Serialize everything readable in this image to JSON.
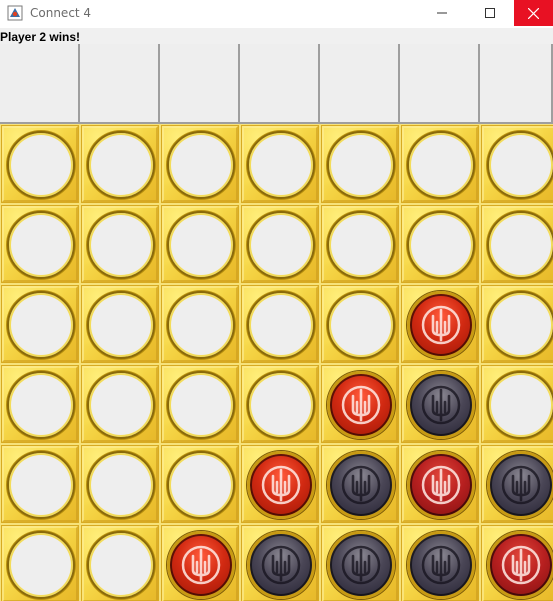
{
  "window": {
    "title": "Connect 4"
  },
  "status": {
    "text": "Player 2 wins!"
  },
  "board": {
    "columns": 7,
    "rows": 6,
    "colors": {
      "player1": "#d22a12",
      "player2": "#4a4656",
      "board": "#f3cd36",
      "empty": "#eeeeee"
    },
    "grid": [
      [
        "empty",
        "empty",
        "empty",
        "empty",
        "empty",
        "empty",
        "empty"
      ],
      [
        "empty",
        "empty",
        "empty",
        "empty",
        "empty",
        "empty",
        "empty"
      ],
      [
        "empty",
        "empty",
        "empty",
        "empty",
        "empty",
        "red",
        "empty"
      ],
      [
        "empty",
        "empty",
        "empty",
        "empty",
        "red",
        "dark",
        "empty"
      ],
      [
        "empty",
        "empty",
        "empty",
        "red",
        "dark",
        "red-dim",
        "dark"
      ],
      [
        "empty",
        "empty",
        "red",
        "dark",
        "dark",
        "dark",
        "red-dim"
      ]
    ]
  }
}
